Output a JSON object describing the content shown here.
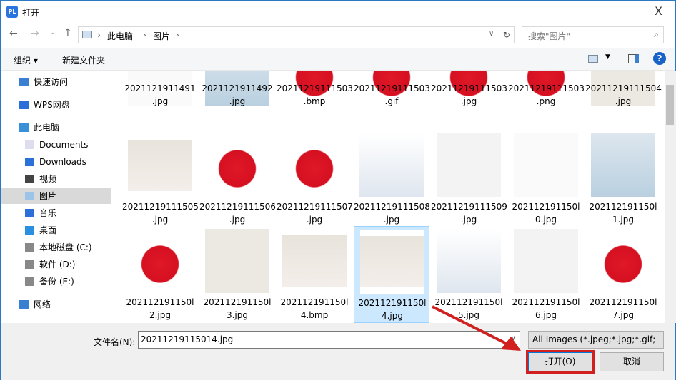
{
  "window": {
    "title": "打开",
    "close": "X",
    "app_icon": "PL"
  },
  "nav": {
    "breadcrumb": [
      "此电脑",
      "图片"
    ],
    "search_placeholder": "搜索\"图片\""
  },
  "toolbar": {
    "organize": "组织 ▾",
    "new_folder": "新建文件夹"
  },
  "sidebar": [
    {
      "label": "快速访问",
      "icon": "star-icon"
    },
    {
      "label": "WPS网盘",
      "icon": "cloud-icon"
    },
    {
      "label": "此电脑",
      "icon": "computer-icon"
    },
    {
      "label": "Documents",
      "icon": "document-icon"
    },
    {
      "label": "Downloads",
      "icon": "download-icon"
    },
    {
      "label": "视频",
      "icon": "video-icon"
    },
    {
      "label": "图片",
      "icon": "picture-icon",
      "selected": true
    },
    {
      "label": "音乐",
      "icon": "music-icon"
    },
    {
      "label": "桌面",
      "icon": "desktop-icon"
    },
    {
      "label": "本地磁盘 (C:)",
      "icon": "drive-icon"
    },
    {
      "label": "软件 (D:)",
      "icon": "drive-icon"
    },
    {
      "label": "备份 (E:)",
      "icon": "drive-icon"
    },
    {
      "label": "网络",
      "icon": "network-icon"
    }
  ],
  "files": [
    {
      "l1": "2021121911491",
      "l2": ".jpg",
      "t": "text"
    },
    {
      "l1": "2021121911492",
      "l2": ".jpg",
      "t": "boy"
    },
    {
      "l1": "20211219111503",
      "l2": ".bmp",
      "t": "straw"
    },
    {
      "l1": "20211219111503",
      "l2": ".gif",
      "t": "straw"
    },
    {
      "l1": "20211219111503",
      "l2": ".jpg",
      "t": "straw"
    },
    {
      "l1": "20211219111503",
      "l2": ".png",
      "t": "straw"
    },
    {
      "l1": "20211219111504",
      "l2": ".jpg",
      "t": "girl"
    },
    {
      "l1": "20211219111505",
      "l2": ".jpg",
      "t": "doc"
    },
    {
      "l1": "20211219111506",
      "l2": ".jpg",
      "t": "straw"
    },
    {
      "l1": "20211219111507",
      "l2": ".jpg",
      "t": "straw"
    },
    {
      "l1": "20211219111508",
      "l2": ".jpg",
      "t": "poem"
    },
    {
      "l1": "20211219111509",
      "l2": ".jpg",
      "t": "ham"
    },
    {
      "l1": "202112191150l",
      "l2": "0.jpg",
      "t": "text"
    },
    {
      "l1": "202112191150l",
      "l2": "1.jpg",
      "t": "boy"
    },
    {
      "l1": "202112191150l",
      "l2": "2.jpg",
      "t": "straw"
    },
    {
      "l1": "202112191150l",
      "l2": "3.jpg",
      "t": "girl"
    },
    {
      "l1": "202112191150l",
      "l2": "4.bmp",
      "t": "doc"
    },
    {
      "l1": "202112191150l",
      "l2": "4.jpg",
      "t": "doc",
      "selected": true
    },
    {
      "l1": "202112191150l",
      "l2": "5.jpg",
      "t": "poem"
    },
    {
      "l1": "202112191150l",
      "l2": "6.jpg",
      "t": "ham"
    },
    {
      "l1": "202112191150l",
      "l2": "7.jpg",
      "t": "straw"
    }
  ],
  "bottom": {
    "filename_label": "文件名(N):",
    "filename_value": "20211219115014.jpg",
    "filter": "All Images (*.jpeg;*.jpg;*.gif;",
    "open": "打开(O)",
    "cancel": "取消"
  },
  "colors": {
    "accent": "#0078d7",
    "highlight": "#d02020",
    "selection": "#cce8ff"
  }
}
